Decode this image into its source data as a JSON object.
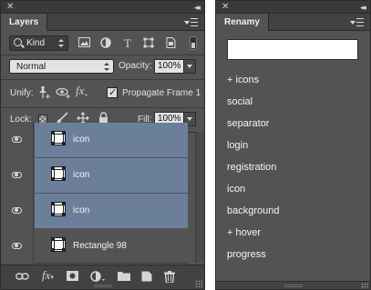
{
  "layers_panel": {
    "tab_label": "Layers",
    "filter": {
      "kind_label": "Kind"
    },
    "blend_mode": "Normal",
    "opacity_label": "Opacity:",
    "opacity_value": "100%",
    "unify_label": "Unify:",
    "propagate_label": "Propagate Frame 1",
    "propagate_checked": true,
    "lock_label": "Lock:",
    "fill_label": "Fill:",
    "fill_value": "100%",
    "fx_label": "fx",
    "layers": [
      {
        "name": "icon",
        "selected": true,
        "visible": true
      },
      {
        "name": "icon",
        "selected": true,
        "visible": true
      },
      {
        "name": "icon",
        "selected": true,
        "visible": true
      },
      {
        "name": "Rectangle 98",
        "selected": false,
        "visible": true
      }
    ],
    "bottom_fx_label": "fx",
    "selection_color": "#6b7f9a"
  },
  "renamy_panel": {
    "tab_label": "Renamy",
    "input_value": "",
    "items": [
      "+ icons",
      "social",
      "separator",
      "login",
      "registration",
      "icon",
      "background",
      "+ hover",
      "progress"
    ]
  }
}
